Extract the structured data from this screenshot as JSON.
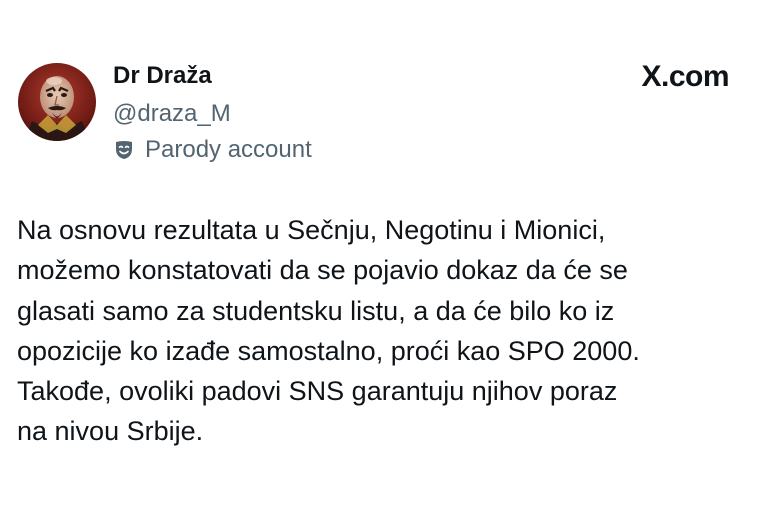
{
  "author": {
    "display_name": "Dr Draža",
    "handle": "@draza_M",
    "badge_label": "Parody account",
    "badge_icon": "theater-mask-icon"
  },
  "brand": {
    "label": "X.com"
  },
  "tweet": {
    "lines": [
      "Na osnovu rezultata u Sečnju, Negotinu i Mionici,",
      "možemo konstatovati da se pojavio dokaz da će se",
      "glasati samo za studentsku listu, a da će bilo ko iz",
      "opozicije ko izađe samostalno, proći kao SPO 2000.",
      "Takođe, ovoliki padovi SNS garantuju njihov poraz",
      "na nivou Srbije."
    ]
  },
  "colors": {
    "text_primary": "#0f1419",
    "text_secondary": "#536471",
    "background": "#ffffff"
  }
}
